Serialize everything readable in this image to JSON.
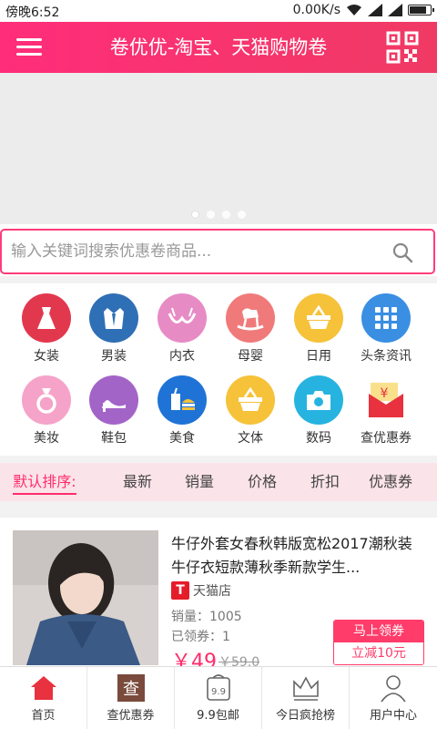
{
  "status_bar": {
    "time": "傍晚6:52",
    "net_speed": "0.00K/s"
  },
  "header": {
    "title": "卷优优-淘宝、天猫购物卷"
  },
  "banner": {
    "dot_count": 4,
    "active_index": 0
  },
  "search": {
    "placeholder": "输入关键词搜索优惠卷商品..."
  },
  "categories": [
    {
      "label": "女装",
      "icon": "dress-icon",
      "color": "#e2384e"
    },
    {
      "label": "男装",
      "icon": "suit-icon",
      "color": "#2f6fb5"
    },
    {
      "label": "内衣",
      "icon": "bra-icon",
      "color": "#e78bc5"
    },
    {
      "label": "母婴",
      "icon": "rocking-horse-icon",
      "color": "#f07a7a"
    },
    {
      "label": "日用",
      "icon": "basket-icon",
      "color": "#f5c23a"
    },
    {
      "label": "头条资讯",
      "icon": "grid-icon",
      "color": "#3a8fe3"
    },
    {
      "label": "美妆",
      "icon": "ring-icon",
      "color": "#f5a3c8"
    },
    {
      "label": "鞋包",
      "icon": "high-heel-icon",
      "color": "#a364c8"
    },
    {
      "label": "美食",
      "icon": "food-icon",
      "color": "#1f73d6"
    },
    {
      "label": "文体",
      "icon": "basket-icon",
      "color": "#f5c23a"
    },
    {
      "label": "数码",
      "icon": "camera-icon",
      "color": "#27b3e0"
    },
    {
      "label": "查优惠券",
      "icon": "red-envelope-icon",
      "color": "#e8323f"
    }
  ],
  "sort_tabs": [
    {
      "label": "默认排序:",
      "active": true
    },
    {
      "label": "最新",
      "active": false
    },
    {
      "label": "销量",
      "active": false
    },
    {
      "label": "价格",
      "active": false
    },
    {
      "label": "折扣",
      "active": false
    },
    {
      "label": "优惠券",
      "active": false
    }
  ],
  "product": {
    "title": "牛仔外套女春秋韩版宽松2017潮秋装牛仔衣短款薄秋季新款学生...",
    "shop_badge": "T",
    "shop": "天猫店",
    "sales": "销量：1005",
    "coupon_used": "已领券：1",
    "price": "￥49",
    "original_price": "￥59.0",
    "coupon_button_top": "马上领券",
    "coupon_button_bottom": "立减10元"
  },
  "bottom_nav": [
    {
      "label": "首页",
      "icon": "home-icon",
      "active": true
    },
    {
      "label": "查优惠券",
      "icon": "coupon-search-icon",
      "active": false
    },
    {
      "label": "9.9包邮",
      "icon": "price-tag-icon",
      "active": false
    },
    {
      "label": "今日疯抢榜",
      "icon": "crown-icon",
      "active": false
    },
    {
      "label": "用户中心",
      "icon": "user-icon",
      "active": false
    }
  ],
  "colors": {
    "accent": "#ff2d7a",
    "accent_text": "#ff2d6a",
    "sortbar_bg": "#fbe3ea"
  }
}
